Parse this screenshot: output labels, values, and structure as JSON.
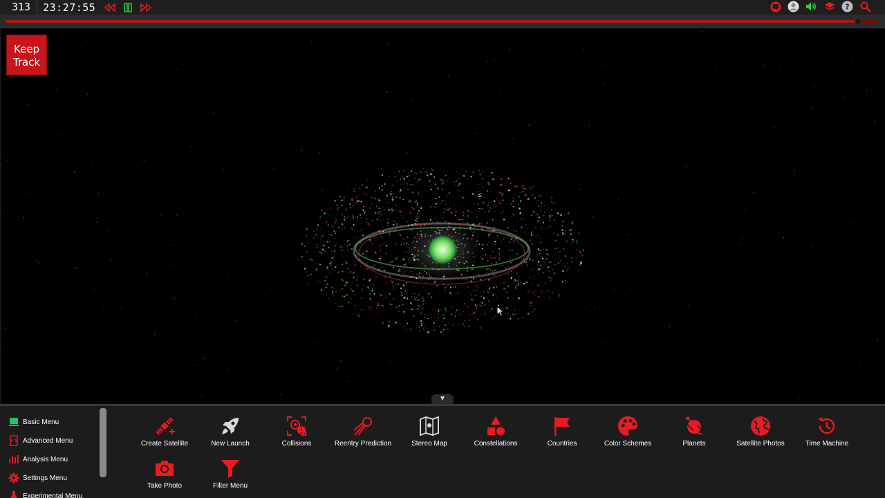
{
  "topbar": {
    "day": "313",
    "time": "23:27:55",
    "time_controls": [
      {
        "name": "rewind-icon"
      },
      {
        "name": "pause-icon"
      },
      {
        "name": "fast-forward-icon"
      }
    ],
    "right_icons": [
      "github-icon",
      "user-icon",
      "volume-icon",
      "layers-icon",
      "help-icon",
      "search-icon"
    ]
  },
  "logo": {
    "line1": "Keep",
    "line2": "Track"
  },
  "drawer_toggle": "▼",
  "side_menu": [
    {
      "label": "Basic Menu",
      "icon": "basic-menu-icon",
      "color": "#22c55e"
    },
    {
      "label": "Advanced Menu",
      "icon": "advanced-menu-icon",
      "color": "#e81a22"
    },
    {
      "label": "Analysis Menu",
      "icon": "analysis-menu-icon",
      "color": "#e81a22"
    },
    {
      "label": "Settings Menu",
      "icon": "settings-menu-icon",
      "color": "#e81a22"
    },
    {
      "label": "Experimental Menu",
      "icon": "experimental-menu-icon",
      "color": "#e81a22"
    }
  ],
  "tools": [
    {
      "label": "Create Satellite",
      "icon": "create-satellite-icon"
    },
    {
      "label": "New Launch",
      "icon": "rocket-icon"
    },
    {
      "label": "Collisions",
      "icon": "collisions-icon"
    },
    {
      "label": "Reentry Prediction",
      "icon": "reentry-icon"
    },
    {
      "label": "Stereo Map",
      "icon": "map-icon"
    },
    {
      "label": "Constellations",
      "icon": "constellations-icon"
    },
    {
      "label": "Countries",
      "icon": "flag-icon"
    },
    {
      "label": "Color Schemes",
      "icon": "palette-icon"
    },
    {
      "label": "Planets",
      "icon": "planet-icon"
    },
    {
      "label": "Satellite Photos",
      "icon": "globe-icon"
    },
    {
      "label": "Time Machine",
      "icon": "history-icon"
    },
    {
      "label": "Take Photo",
      "icon": "camera-icon"
    },
    {
      "label": "Filter Menu",
      "icon": "filter-icon"
    }
  ],
  "colors": {
    "accent": "#e81a22",
    "play_green": "#2ecc40",
    "active_menu": "#22c55e"
  }
}
